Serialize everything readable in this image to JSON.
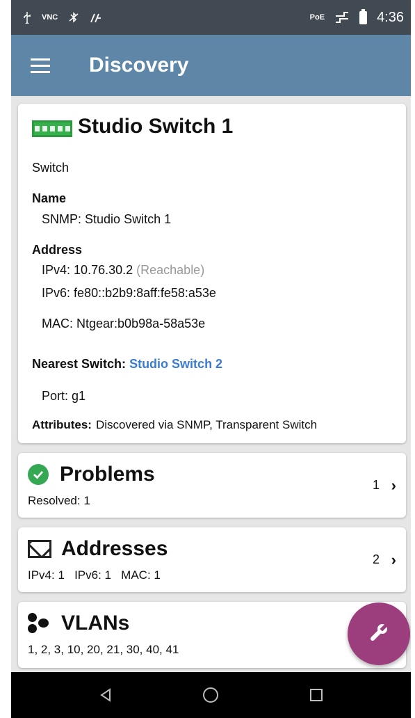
{
  "status_bar": {
    "left_icons": [
      "usb-icon",
      "vnc-icon",
      "bluetooth-off-icon",
      "signal-icon"
    ],
    "vnc_label": "VNC",
    "poe_label": "PoE",
    "time": "4:36"
  },
  "app_bar": {
    "title": "Discovery"
  },
  "device": {
    "name": "Studio Switch 1",
    "type": "Switch",
    "name_label": "Name",
    "snmp_label": "SNMP:",
    "snmp_value": "Studio Switch 1",
    "address_label": "Address",
    "ipv4_label": "IPv4:",
    "ipv4_value": "10.76.30.2",
    "ipv4_status": "(Reachable)",
    "ipv6_label": "IPv6:",
    "ipv6_value": "fe80::b2b9:8aff:fe58:a53e",
    "mac_label": "MAC:",
    "mac_value": "Ntgear:b0b98a-58a53e",
    "nearest_switch_label": "Nearest Switch:",
    "nearest_switch_value": "Studio Switch 2",
    "port_label": "Port:",
    "port_value": "g1",
    "attributes_label": "Attributes:",
    "attributes_value": "Discovered via SNMP, Transparent Switch"
  },
  "problems": {
    "title": "Problems",
    "subtitle": "Resolved: 1",
    "count": "1"
  },
  "addresses": {
    "title": "Addresses",
    "subtitle": "IPv4: 1   IPv6: 1   MAC: 1",
    "count": "2"
  },
  "vlans": {
    "title": "VLANs",
    "subtitle": "1, 2, 3, 10, 20, 21, 30, 40, 41"
  },
  "fab": {
    "icon": "wrench-icon",
    "color": "#9c3e7d"
  },
  "nav_bar": {
    "buttons": [
      "back-icon",
      "home-icon",
      "recents-icon"
    ]
  },
  "colors": {
    "status_bar": "#414a52",
    "app_bar": "#5e87a7",
    "link": "#3a7bd5",
    "success": "#34a853",
    "switch_icon": "#35b04b"
  }
}
